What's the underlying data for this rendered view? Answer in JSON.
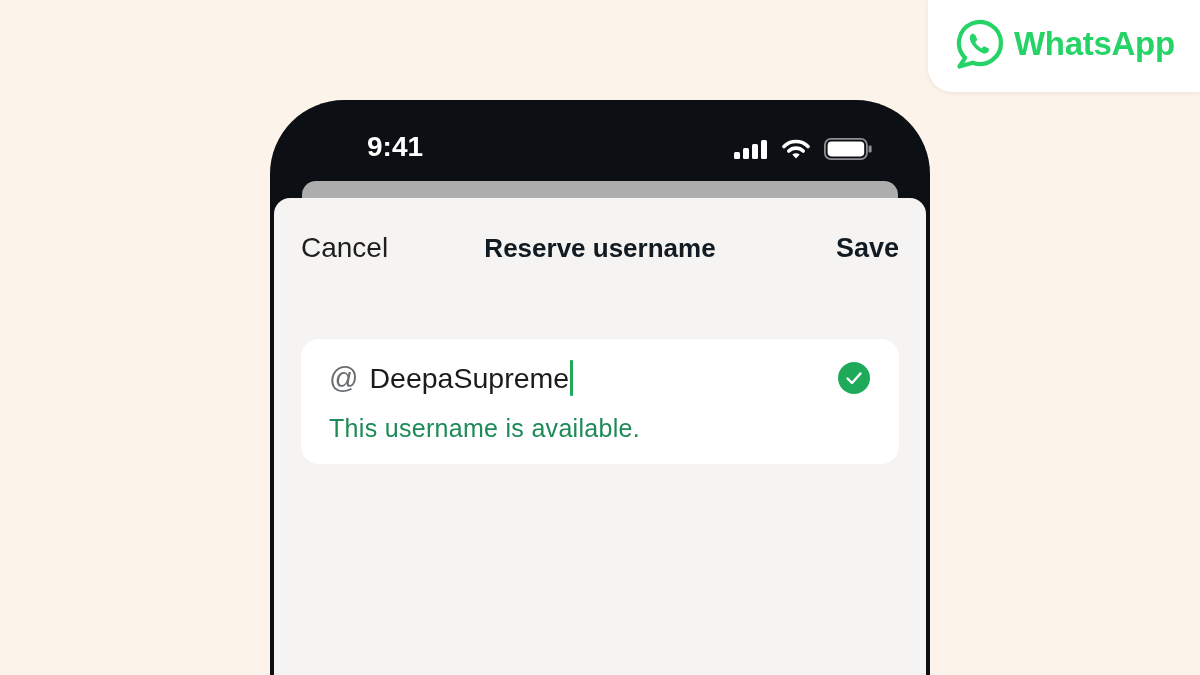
{
  "logo": {
    "wordmark": "WhatsApp"
  },
  "status_bar": {
    "time": "9:41"
  },
  "sheet": {
    "cancel": "Cancel",
    "title": "Reserve username",
    "save": "Save",
    "username_field": {
      "prefix": "@",
      "value": "DeepaSupreme",
      "focused": true,
      "available": true,
      "message": "This username is available."
    }
  }
}
